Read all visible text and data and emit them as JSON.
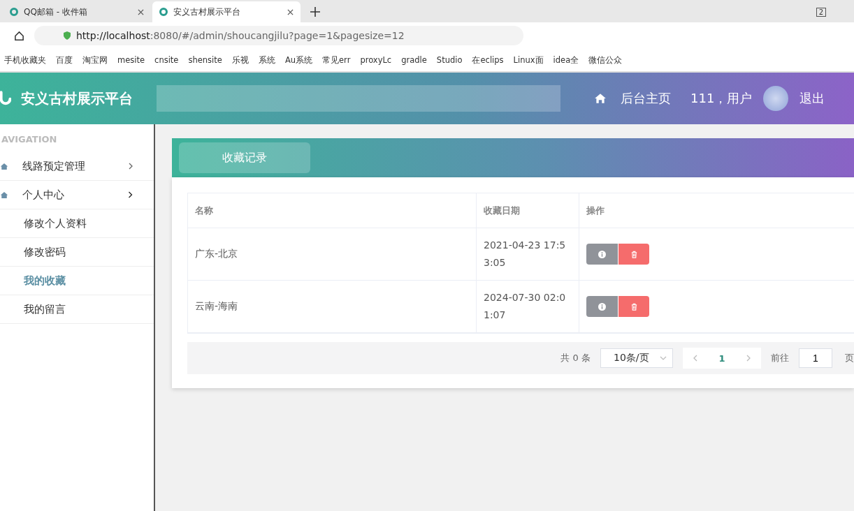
{
  "browser": {
    "tabs": [
      {
        "title": "QQ邮箱 - 收件箱",
        "selected": false
      },
      {
        "title": "安义古村展示平台",
        "selected": true
      }
    ],
    "tab_count": "2",
    "url_host": "http://localhost",
    "url_rest": ":8080/#/admin/shoucangjilu?page=1&pagesize=12",
    "bookmarks": [
      "手机收藏夹",
      "百度",
      "淘宝网",
      "mesite",
      "cnsite",
      "shensite",
      "乐视",
      "系统",
      "Au系统",
      "常见err",
      "proxyLc",
      "gradle",
      "Studio",
      "在eclips",
      "Linux面",
      "idea全",
      "微信公众"
    ]
  },
  "header": {
    "title": "安义古村展示平台",
    "home": "后台主页",
    "user": "111，用户",
    "logout": "退出"
  },
  "sidebar": {
    "heading": "AVIGATION",
    "items": [
      {
        "label": "线路预定管理",
        "expanded": false
      },
      {
        "label": "个人中心",
        "expanded": true,
        "children": [
          {
            "label": "修改个人资料",
            "selected": false
          },
          {
            "label": "修改密码",
            "selected": false
          },
          {
            "label": "我的收藏",
            "selected": true
          },
          {
            "label": "我的留言",
            "selected": false
          }
        ]
      }
    ]
  },
  "page_tab": "收藏记录",
  "table": {
    "columns": [
      "名称",
      "收藏日期",
      "操作"
    ],
    "rows": [
      {
        "name": "广东-北京",
        "date": "2021-04-23 17:53:05"
      },
      {
        "name": "云南-海南",
        "date": "2024-07-30 02:01:07"
      }
    ]
  },
  "pagination": {
    "total": "共 0 条",
    "page_size": "10条/页",
    "pages": [
      {
        "label": "1",
        "selected": true
      }
    ],
    "goto_label": "前往",
    "goto_value": "1",
    "goto_unit": "页"
  }
}
